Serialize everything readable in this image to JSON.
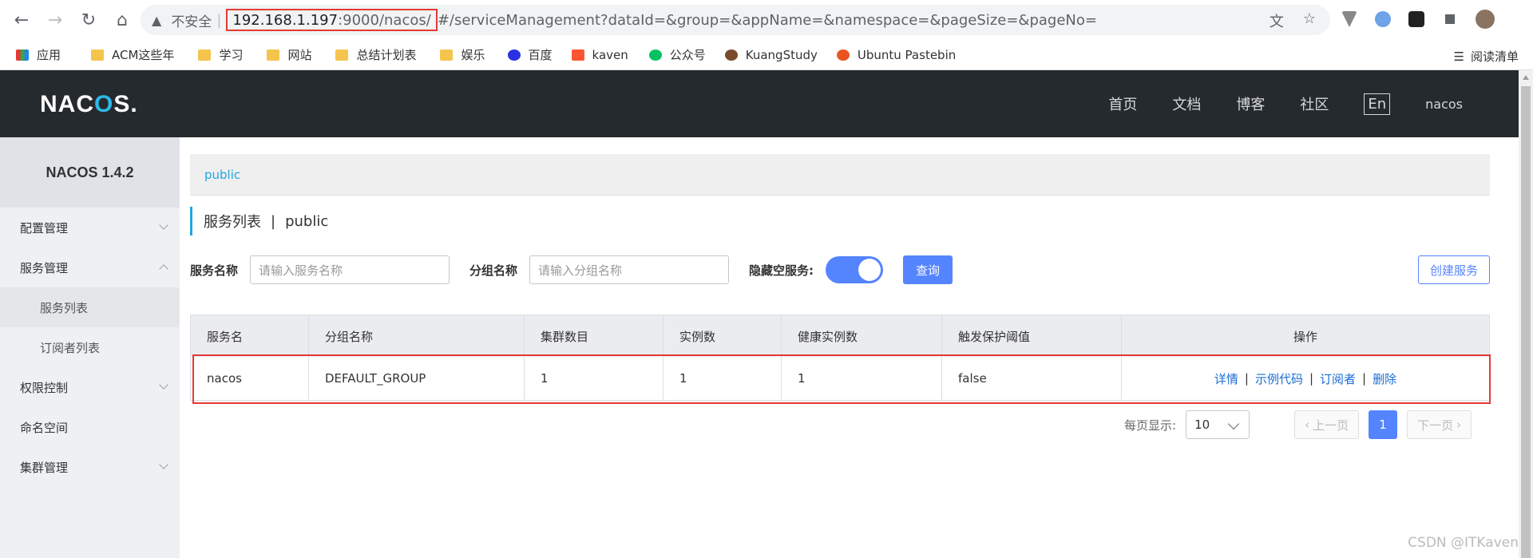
{
  "browser": {
    "insecure_label": "不安全",
    "url_host": "192.168.1.197",
    "url_port": ":9000",
    "url_path": "/nacos/",
    "url_rest": "#/serviceManagement?dataId=&group=&appName=&namespace=&pageSize=&pageNo=",
    "bookmarks": [
      "应用",
      "ACM这些年",
      "学习",
      "网站",
      "总结计划表",
      "娱乐",
      "百度",
      "kaven",
      "公众号",
      "KuangStudy",
      "Ubuntu Pastebin"
    ],
    "reading_list": "阅读清单"
  },
  "header": {
    "logo_pre": "NAC",
    "logo_o": "O",
    "logo_post": "S.",
    "nav": [
      "首页",
      "文档",
      "博客",
      "社区"
    ],
    "lang": "En",
    "user": "nacos"
  },
  "sidebar": {
    "title": "NACOS 1.4.2",
    "items": [
      {
        "label": "配置管理"
      },
      {
        "label": "服务管理"
      },
      {
        "label": "服务列表"
      },
      {
        "label": "订阅者列表"
      },
      {
        "label": "权限控制"
      },
      {
        "label": "命名空间"
      },
      {
        "label": "集群管理"
      }
    ]
  },
  "main": {
    "namespace_tab": "public",
    "title": "服务列表",
    "title_sep": "|",
    "title_ns": "public",
    "filter": {
      "service_label": "服务名称",
      "service_placeholder": "请输入服务名称",
      "group_label": "分组名称",
      "group_placeholder": "请输入分组名称",
      "hide_empty_label": "隐藏空服务:",
      "hide_empty_on": true,
      "query_button": "查询",
      "create_button": "创建服务"
    },
    "table": {
      "headers": [
        "服务名",
        "分组名称",
        "集群数目",
        "实例数",
        "健康实例数",
        "触发保护阈值",
        "操作"
      ],
      "rows": [
        [
          "nacos",
          "DEFAULT_GROUP",
          "1",
          "1",
          "1",
          "false"
        ]
      ],
      "actions": [
        "详情",
        "示例代码",
        "订阅者",
        "删除"
      ],
      "action_sep": "|"
    },
    "pagination": {
      "per_page_label": "每页显示:",
      "per_page": "10",
      "prev": "上一页",
      "current": "1",
      "next": "下一页"
    }
  },
  "watermark": "CSDN @ITKaven",
  "colors": {
    "accent": "#5584ff",
    "header_bg": "#252a2f",
    "highlight": "#e53935",
    "link": "#1a6dd6"
  }
}
